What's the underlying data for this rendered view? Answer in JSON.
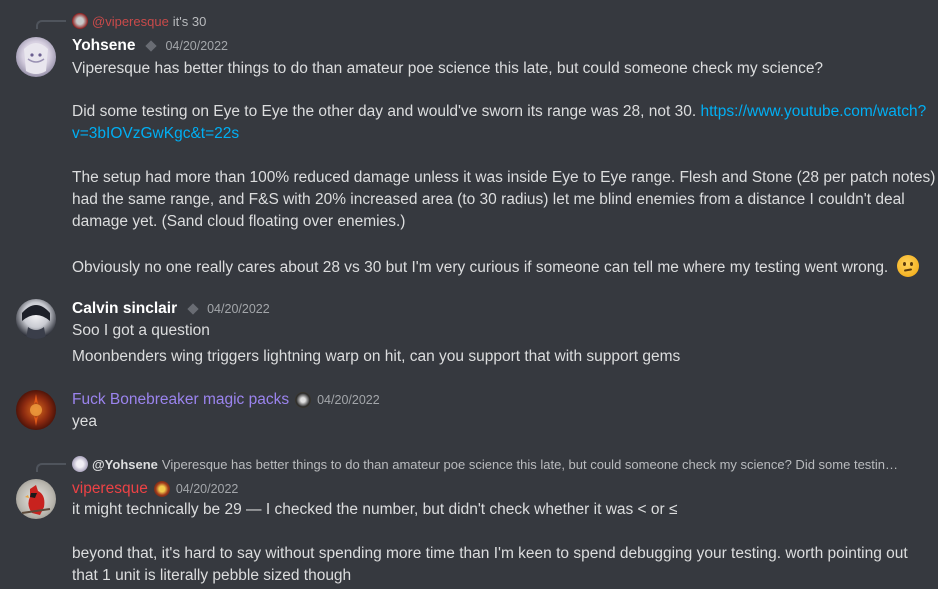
{
  "messages": [
    {
      "reply": {
        "mention": "@viperesque",
        "text": "it's 30"
      },
      "author": "Yohsene",
      "timestamp": "04/20/2022",
      "lines": [
        "Viperesque has better things to do than amateur poe science this late, but could someone check my science?",
        "Did some testing on Eye to Eye the other day and would've sworn its range was 28, not 30.",
        "v=3bIOVzGwKgc&t=22s",
        "The setup had more than 100% reduced damage unless it was inside Eye to Eye range. Flesh and Stone (28 per patch notes)",
        "had the same range, and F&S with 20% increased area (to 30 radius) let me blind enemies from a distance I couldn't deal",
        "damage yet. (Sand cloud floating over enemies.)",
        "Obviously no one really cares about 28 vs 30 but I'm very curious if someone can tell me where my testing went wrong."
      ],
      "link_part1": "https://www.youtube.com/watch?",
      "emoji": "thinking-face-emoji"
    },
    {
      "author": "Calvin sinclair",
      "timestamp": "04/20/2022",
      "lines": [
        "Soo I got a question",
        "Moonbenders wing triggers lightning warp on hit, can you support that with support gems"
      ]
    },
    {
      "author": "Fuck Bonebreaker magic packs",
      "timestamp": "04/20/2022",
      "lines": [
        "yea"
      ]
    },
    {
      "reply": {
        "mention": "@Yohsene",
        "text": "Viperesque has better things to do than amateur poe science this late, but could someone check my science?  Did some testing o..."
      },
      "author": "viperesque",
      "timestamp": "04/20/2022",
      "lines": [
        "it might technically be 29 — I checked the number, but didn't check whether it was < or ≤",
        "beyond that, it's hard to say without spending more time than I'm keen to spend debugging your testing. worth pointing out",
        "that 1 unit is literally pebble sized though"
      ]
    }
  ],
  "colors": {
    "background": "#36393f",
    "link": "#00aff4",
    "viperesque_name": "#ed4245",
    "bonebreaker_name": "#9b84ee"
  }
}
